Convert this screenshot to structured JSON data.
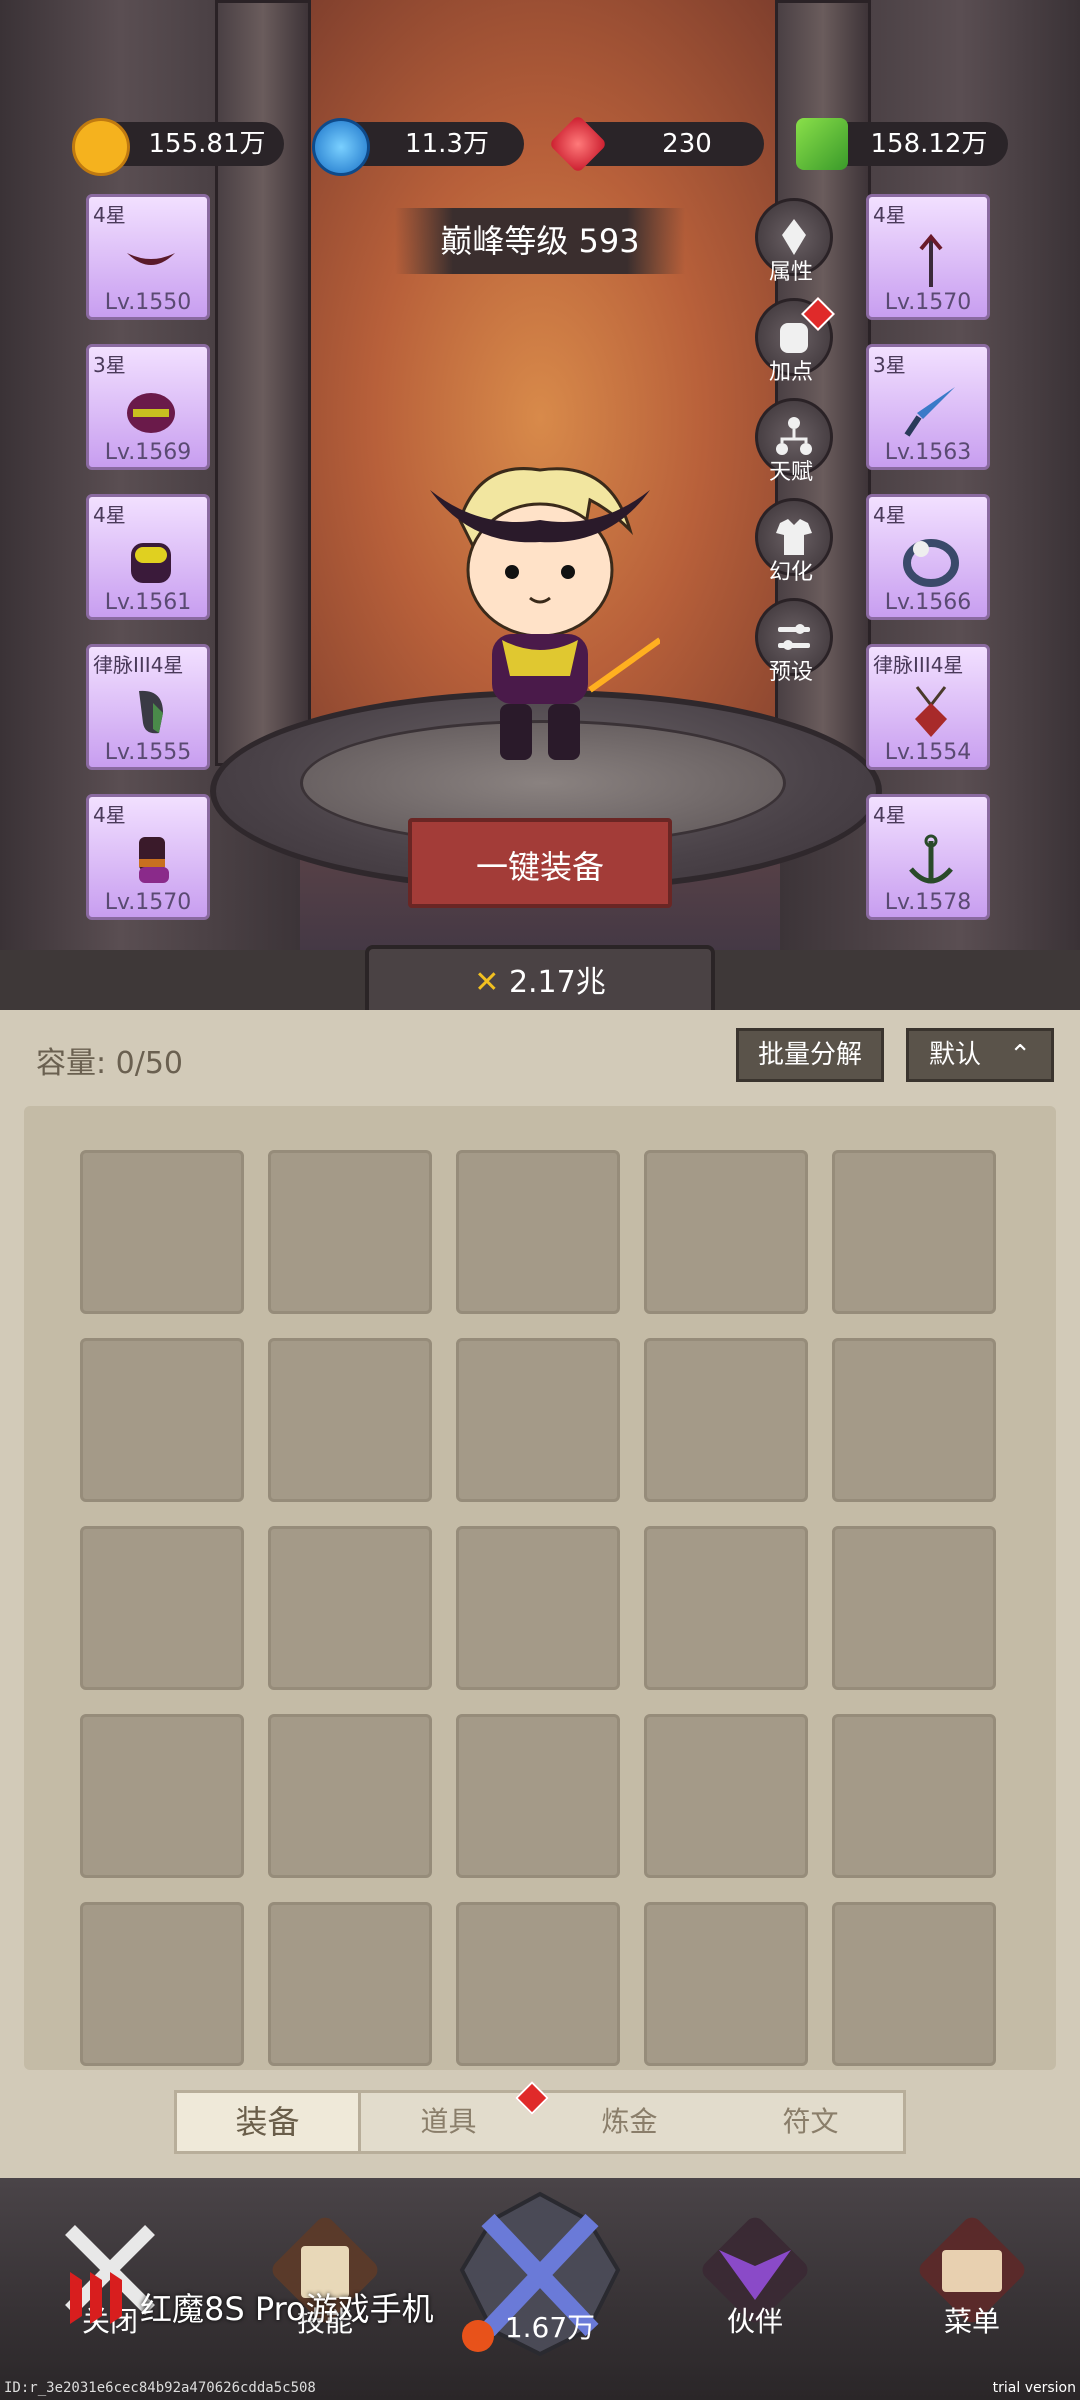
{
  "currencies": [
    {
      "name": "gold-icon",
      "value": "155.81万",
      "color": "#f5b21e"
    },
    {
      "name": "diamond-blue-icon",
      "value": "11.3万",
      "color": "#2f9fe8"
    },
    {
      "name": "ruby-icon",
      "value": "230",
      "color": "#e8323c"
    },
    {
      "name": "cash-icon",
      "value": "158.12万",
      "color": "#5ac83c"
    }
  ],
  "peak_level": "巅峰等级 593",
  "left_slots": [
    {
      "star": "4星",
      "level": "Lv.1550",
      "icon": "horns-icon"
    },
    {
      "star": "3星",
      "level": "Lv.1569",
      "icon": "helmet-icon"
    },
    {
      "star": "4星",
      "level": "Lv.1561",
      "icon": "armor-icon"
    },
    {
      "star": "律脉III4星",
      "level": "Lv.1555",
      "icon": "gauntlet-icon"
    },
    {
      "star": "4星",
      "level": "Lv.1570",
      "icon": "boots-icon"
    }
  ],
  "right_slots": [
    {
      "star": "4星",
      "level": "Lv.1570",
      "icon": "trident-icon"
    },
    {
      "star": "3星",
      "level": "Lv.1563",
      "icon": "dagger-icon"
    },
    {
      "star": "4星",
      "level": "Lv.1566",
      "icon": "ring-icon"
    },
    {
      "star": "律脉III4星",
      "level": "Lv.1554",
      "icon": "amulet-icon"
    },
    {
      "star": "4星",
      "level": "Lv.1578",
      "icon": "anchor-icon"
    }
  ],
  "side_buttons": [
    {
      "label": "属性",
      "icon": "attributes-icon",
      "badge": false
    },
    {
      "label": "加点",
      "icon": "fist-icon",
      "badge": true
    },
    {
      "label": "天赋",
      "icon": "talent-tree-icon",
      "badge": false
    },
    {
      "label": "幻化",
      "icon": "shirt-icon",
      "badge": false
    },
    {
      "label": "预设",
      "icon": "sliders-icon",
      "badge": false
    }
  ],
  "equip_all_label": "一键装备",
  "combat_power": "2.17兆",
  "capacity": "容量: 0/50",
  "batch_decompose": "批量分解",
  "sort_default": "默认",
  "tabs": [
    {
      "label": "装备",
      "active": true,
      "badge": false
    },
    {
      "label": "道具",
      "active": false,
      "badge": true
    },
    {
      "label": "炼金",
      "active": false,
      "badge": false
    },
    {
      "label": "符文",
      "active": false,
      "badge": false
    }
  ],
  "nav": [
    {
      "label": "关闭",
      "icon": "close-swords-icon"
    },
    {
      "label": "技能",
      "icon": "skill-book-icon"
    },
    {
      "label": "1.67万",
      "icon": "battle-swords-icon"
    },
    {
      "label": "伙伴",
      "icon": "wings-icon"
    },
    {
      "label": "菜单",
      "icon": "menu-book-icon"
    }
  ],
  "watermark": "红魔8S Pro游戏手机",
  "id_text": "ID:r_3e2031e6cec84b92a470626cdda5c508",
  "trial_text": "trial version"
}
